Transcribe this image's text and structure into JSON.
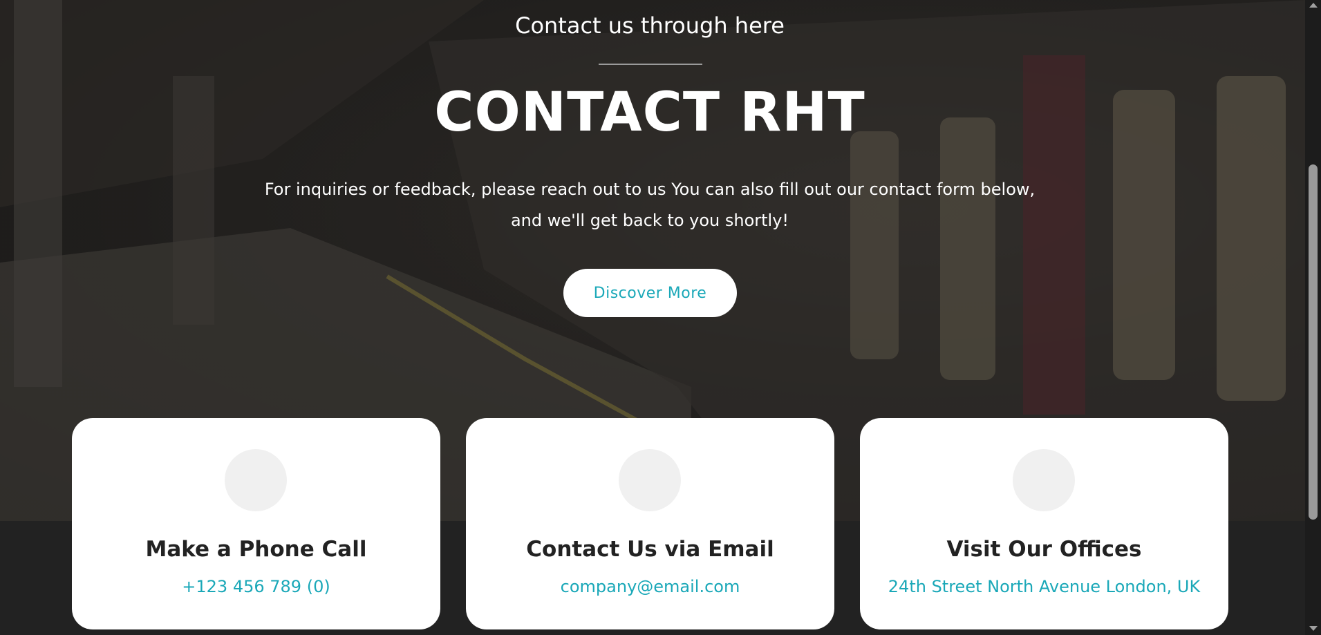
{
  "hero": {
    "subtitle": "Contact us through here",
    "title": "CONTACT RHT",
    "description": "For inquiries or feedback, please reach out to us You can also fill out our contact form below, and we'll get back to you shortly!",
    "cta_label": "Discover More"
  },
  "contact_cards": [
    {
      "icon": "phone-icon",
      "title": "Make a Phone Call",
      "value": "+123 456 789 (0)"
    },
    {
      "icon": "email-icon",
      "title": "Contact Us via Email",
      "value": "company@email.com"
    },
    {
      "icon": "location-icon",
      "title": "Visit Our Offices",
      "value": "24th Street North Avenue London, UK"
    }
  ],
  "colors": {
    "accent": "#1aa8b8",
    "card_background": "#ffffff",
    "heading_text": "#222222",
    "icon_circle": "#f0f0f0",
    "page_background": "#222222"
  }
}
